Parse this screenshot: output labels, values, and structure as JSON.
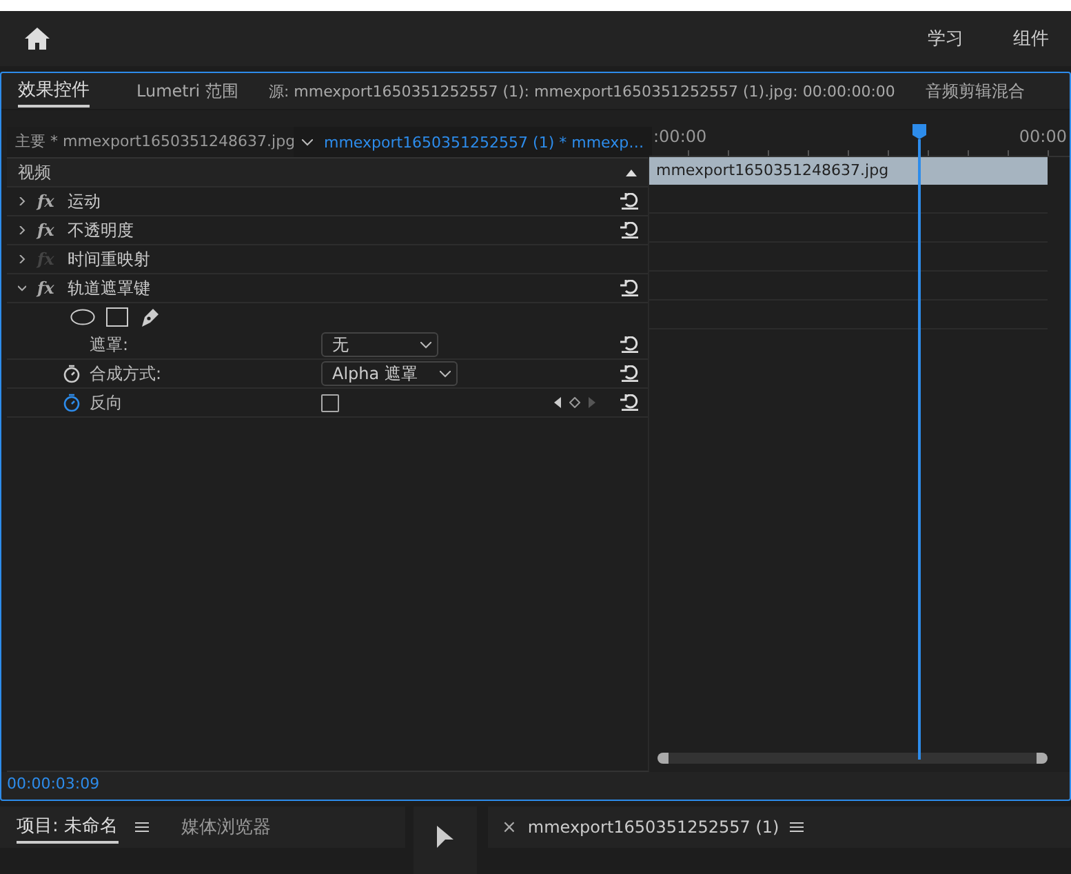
{
  "header": {
    "items": [
      {
        "label": "学习"
      },
      {
        "label": "组件"
      }
    ]
  },
  "panel_tabs": [
    {
      "label": "效果控件",
      "selected": true
    },
    {
      "label": "Lumetri 范围",
      "selected": false
    },
    {
      "label": "源: mmexport1650351252557 (1): mmexport1650351252557 (1).jpg: 00:00:00:00",
      "selected": false
    },
    {
      "label": "音频剪辑混合",
      "selected": false
    }
  ],
  "source_tabs": {
    "master": "主要 * mmexport1650351248637.jpg",
    "clip": "mmexport1650351252557 (1) * mmexp…"
  },
  "section": "视频",
  "effects": [
    {
      "name": "运动",
      "badge": "fx",
      "expanded": false,
      "enabled": true
    },
    {
      "name": "不透明度",
      "badge": "fx",
      "expanded": false,
      "enabled": true
    },
    {
      "name": "时间重映射",
      "badge": "fx",
      "expanded": false,
      "enabled": false
    },
    {
      "name": "轨道遮罩键",
      "badge": "fx",
      "expanded": true,
      "enabled": true,
      "params": [
        {
          "kind": "shapes"
        },
        {
          "kind": "dropdown",
          "label": "遮罩:",
          "value": "无",
          "stopwatch": false
        },
        {
          "kind": "dropdown",
          "label": "合成方式:",
          "value": "Alpha 遮罩",
          "stopwatch": true,
          "animated": false
        },
        {
          "kind": "checkbox",
          "label": "反向",
          "checked": false,
          "stopwatch": true,
          "animated": true
        }
      ]
    }
  ],
  "timeline": {
    "start": ":00:00",
    "end": "00:00",
    "clip": "mmexport1650351248637.jpg"
  },
  "timecode": "00:00:03:09",
  "bottom_tabs": [
    {
      "label": "项目: 未命名",
      "selected": true
    },
    {
      "label": "媒体浏览器",
      "selected": false
    }
  ],
  "sequence_close": "×",
  "sequence_tab": "mmexport1650351252557 (1)"
}
